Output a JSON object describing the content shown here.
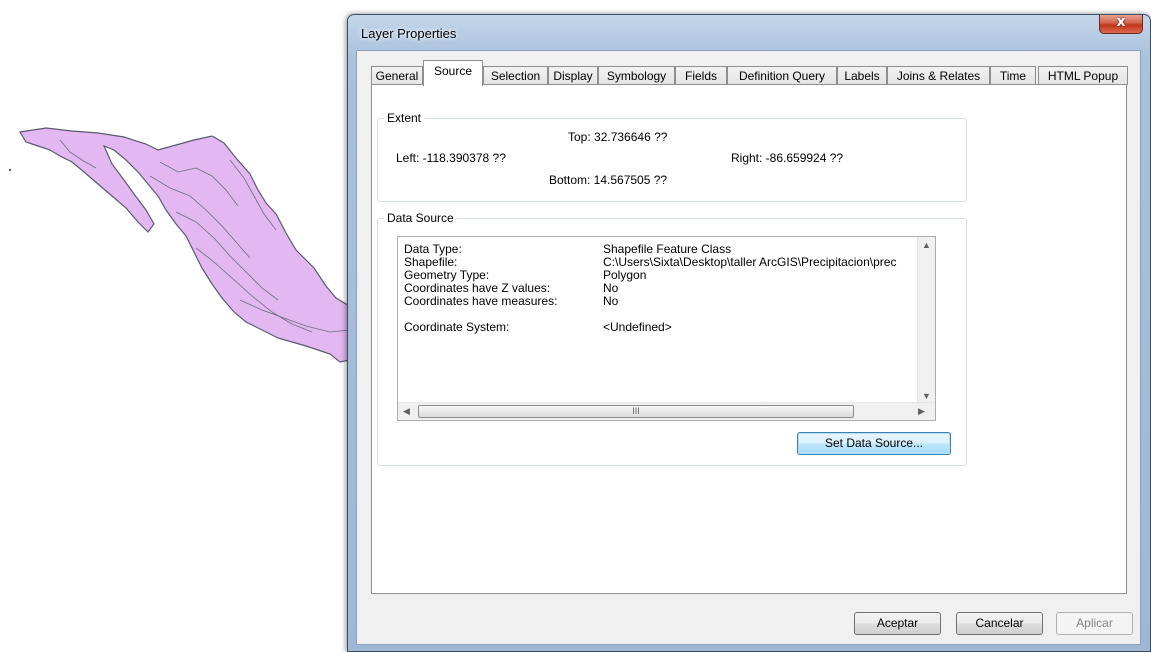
{
  "dialog": {
    "title": "Layer Properties",
    "close_glyph": "x",
    "tabs": [
      {
        "label": "General",
        "active": false
      },
      {
        "label": "Source",
        "active": true
      },
      {
        "label": "Selection",
        "active": false
      },
      {
        "label": "Display",
        "active": false
      },
      {
        "label": "Symbology",
        "active": false
      },
      {
        "label": "Fields",
        "active": false
      },
      {
        "label": "Definition Query",
        "active": false
      },
      {
        "label": "Labels",
        "active": false
      },
      {
        "label": "Joins & Relates",
        "active": false
      },
      {
        "label": "Time",
        "active": false
      },
      {
        "label": "HTML Popup",
        "active": false
      }
    ],
    "extent": {
      "label": "Extent",
      "top": "Top:  32.736646 ??",
      "left": "Left:  -118.390378 ??",
      "right": "Right:  -86.659924 ??",
      "bottom": "Bottom:  14.567505 ??"
    },
    "data_source": {
      "label": "Data Source",
      "rows": [
        {
          "key": "Data Type:",
          "value": "Shapefile Feature Class"
        },
        {
          "key": "Shapefile:",
          "value": "C:\\Users\\Sixta\\Desktop\\taller ArcGIS\\Precipitacion\\prec"
        },
        {
          "key": "Geometry Type:",
          "value": "Polygon"
        },
        {
          "key": "Coordinates have Z values:",
          "value": "No"
        },
        {
          "key": "Coordinates have measures:",
          "value": "No"
        },
        {
          "key": "Coordinate System:",
          "value": "<Undefined>"
        }
      ],
      "scroll_thumb_glyph": "III",
      "set_button": "Set Data Source..."
    },
    "buttons": {
      "ok": "Aceptar",
      "cancel": "Cancelar",
      "apply": "Aplicar"
    }
  },
  "map": {
    "fill_color": "#e3b8f2",
    "stroke_color": "#5a5a6e"
  },
  "colors": {
    "title_bar": "#a9c1dc",
    "close_button": "#c2341a",
    "focus_border": "#3c7fb1"
  },
  "icons": [
    "close-icon",
    "scroll-up-icon",
    "scroll-down-icon",
    "scroll-left-icon",
    "scroll-right-icon",
    "scroll-grip-icon"
  ]
}
